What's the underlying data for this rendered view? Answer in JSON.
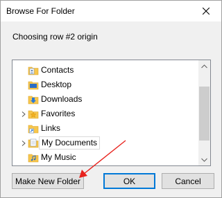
{
  "window": {
    "title": "Browse For Folder",
    "close_icon": "close-icon"
  },
  "description": "Choosing row #2 origin",
  "tree": {
    "items": [
      {
        "label": "Contacts",
        "icon": "contacts-folder-icon",
        "expandable": false,
        "selected": false
      },
      {
        "label": "Desktop",
        "icon": "desktop-folder-icon",
        "expandable": false,
        "selected": false
      },
      {
        "label": "Downloads",
        "icon": "downloads-folder-icon",
        "expandable": false,
        "selected": false
      },
      {
        "label": "Favorites",
        "icon": "favorites-folder-icon",
        "expandable": true,
        "selected": false
      },
      {
        "label": "Links",
        "icon": "links-folder-icon",
        "expandable": false,
        "selected": false
      },
      {
        "label": "My Documents",
        "icon": "documents-folder-icon",
        "expandable": true,
        "selected": true
      },
      {
        "label": "My Music",
        "icon": "music-folder-icon",
        "expandable": false,
        "selected": false
      }
    ]
  },
  "buttons": {
    "make_new_folder": "Make New Folder",
    "ok": "OK",
    "cancel": "Cancel"
  },
  "colors": {
    "annotation_arrow": "#e8231e",
    "focus_border": "#0078d7",
    "folder_yellow": "#f7c64d"
  }
}
